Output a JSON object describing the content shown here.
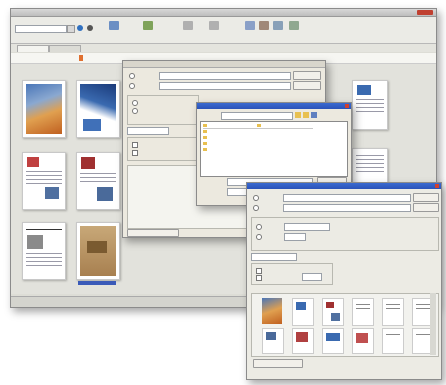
{
  "main_window": {
    "title": "",
    "toolbar": {
      "zoom_value": "",
      "tools": [
        {
          "name": "page-tool-1",
          "color": "#6b8fc4"
        },
        {
          "name": "page-tool-2",
          "color": "#7fa35a"
        },
        {
          "name": "rotate-left",
          "color": "#b0b0b0"
        },
        {
          "name": "rotate-right",
          "color": "#b0b0b0"
        },
        {
          "name": "tool-5",
          "color": "#8aa0c8"
        },
        {
          "name": "tool-6",
          "color": "#a08878"
        },
        {
          "name": "tool-7",
          "color": "#88a0b8"
        },
        {
          "name": "tool-8",
          "color": "#90a890"
        }
      ]
    },
    "tabs": [
      "",
      ""
    ]
  },
  "thumbnails": [
    {
      "label": "",
      "style": "photo-orange"
    },
    {
      "label": "",
      "style": "photo-blue"
    },
    {
      "label": "",
      "style": "doc"
    },
    {
      "label": "",
      "style": "doc"
    },
    {
      "label": "",
      "style": "doc"
    },
    {
      "label": "",
      "style": "tan"
    },
    {
      "label": "",
      "style": "doc"
    },
    {
      "label": "",
      "style": "doc"
    }
  ],
  "export_dialog": {
    "fields": [
      "",
      "",
      ""
    ],
    "options": [
      "",
      "",
      ""
    ]
  },
  "open_dialog": {
    "title": "",
    "files": [
      "",
      "",
      "",
      "",
      "",
      ""
    ],
    "filename_label": "",
    "filetype_label": ""
  },
  "front_dialog": {
    "title": "",
    "group_label": "",
    "preview_label": "",
    "bottom_button": ""
  }
}
